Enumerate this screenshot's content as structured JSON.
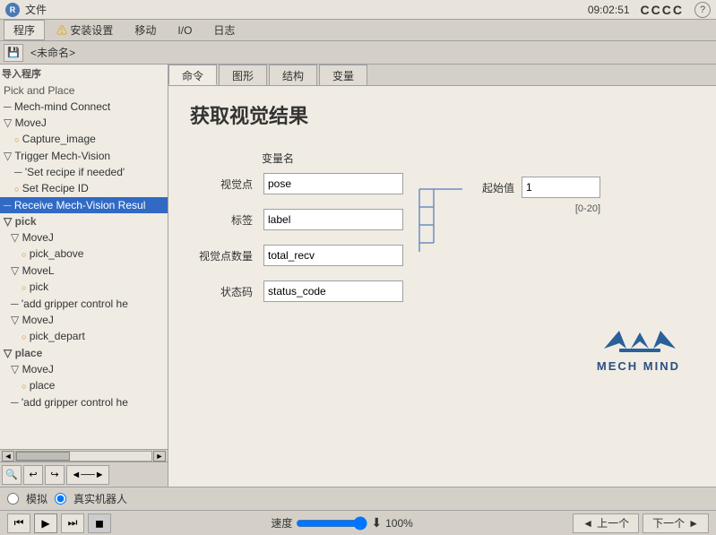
{
  "titlebar": {
    "logo": "R",
    "title": "文件",
    "time": "09:02:51",
    "id": "CCCC",
    "help": "?"
  },
  "menubar": {
    "items": [
      {
        "label": "程序",
        "active": true
      },
      {
        "label": "⚠ 安装设置",
        "warn": true
      },
      {
        "label": "移动"
      },
      {
        "label": "I/O"
      },
      {
        "label": "日志"
      }
    ]
  },
  "toolbar": {
    "save_icon": "💾",
    "name_label": "<未命名>"
  },
  "tabs": [
    {
      "label": "命令",
      "active": true
    },
    {
      "label": "图形"
    },
    {
      "label": "结构"
    },
    {
      "label": "变量"
    }
  ],
  "left_panel": {
    "section": "导入程序",
    "subtitle": "Pick and Place",
    "items": [
      {
        "label": "Mech-mind Connect",
        "level": 0,
        "prefix": "─",
        "type": "line"
      },
      {
        "label": "MoveJ",
        "level": 0,
        "prefix": "▽",
        "type": "tri"
      },
      {
        "label": "Capture_image",
        "level": 1,
        "prefix": "○",
        "type": "dot"
      },
      {
        "label": "Trigger Mech-Vision",
        "level": 0,
        "prefix": "▽",
        "type": "tri"
      },
      {
        "label": "'Set recipe if needed'",
        "level": 1,
        "prefix": "'",
        "type": "str"
      },
      {
        "label": "Set Recipe ID",
        "level": 1,
        "prefix": "○",
        "type": "dot"
      },
      {
        "label": "Receive Mech-Vision Resul",
        "level": 0,
        "prefix": "─",
        "type": "selected"
      },
      {
        "label": "pick",
        "level": 0,
        "prefix": "▽",
        "type": "tri"
      },
      {
        "label": "MoveJ",
        "level": 1,
        "prefix": "▽",
        "type": "tri"
      },
      {
        "label": "pick_above",
        "level": 2,
        "prefix": "○",
        "type": "dot"
      },
      {
        "label": "MoveL",
        "level": 1,
        "prefix": "▽",
        "type": "tri"
      },
      {
        "label": "pick",
        "level": 2,
        "prefix": "○",
        "type": "dot"
      },
      {
        "label": "'add gripper control he",
        "level": 1,
        "prefix": "─",
        "type": "dash"
      },
      {
        "label": "MoveJ",
        "level": 1,
        "prefix": "▽",
        "type": "tri"
      },
      {
        "label": "pick_depart",
        "level": 2,
        "prefix": "○",
        "type": "dot"
      },
      {
        "label": "place",
        "level": 0,
        "prefix": "▽",
        "type": "section"
      },
      {
        "label": "MoveJ",
        "level": 1,
        "prefix": "▽",
        "type": "tri"
      },
      {
        "label": "place",
        "level": 2,
        "prefix": "○",
        "type": "dot"
      },
      {
        "label": "'add gripper control he",
        "level": 1,
        "prefix": "─",
        "type": "dash"
      }
    ]
  },
  "content": {
    "title": "获取视觉结果",
    "variable_section_label": "变量名",
    "fields": [
      {
        "label": "视觉点",
        "value": "pose"
      },
      {
        "label": "标签",
        "value": "label"
      },
      {
        "label": "视觉点数量",
        "value": "total_recv"
      },
      {
        "label": "状态码",
        "value": "status_code"
      }
    ],
    "start_value_label": "起始值",
    "start_value": "1",
    "range_label": "[0-20]"
  },
  "bottom_bar": {
    "simulate_label": "模拟",
    "real_robot_label": "真实机器人"
  },
  "playback": {
    "speed_label": "速度",
    "speed_value": "100%",
    "prev_label": "◄ 上一个",
    "next_label": "下一个 ►"
  }
}
